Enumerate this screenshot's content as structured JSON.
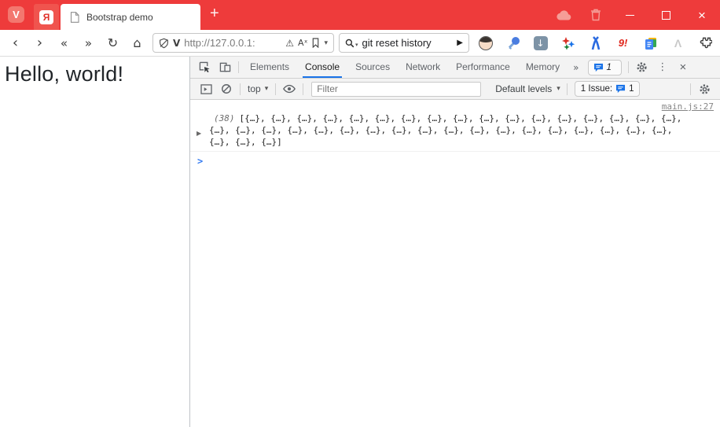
{
  "titlebar": {
    "vivaldi_logo": "V",
    "pinned_tab_letter": "Я",
    "tab_title": "Bootstrap demo",
    "new_tab": "+",
    "close": "×"
  },
  "navbar": {
    "back": "‹",
    "forward": "›",
    "rewind": "«",
    "fast_forward": "»",
    "reload": "↻",
    "home": "⌂",
    "address": {
      "url": "http://127.0.0.1:",
      "warning": "⚠",
      "translate": "Aˣ",
      "caret": "▾"
    },
    "search": {
      "value": "git reset history",
      "go": "▶",
      "caret": "▾"
    },
    "extensions": {
      "download_arrow": "↓",
      "red_badge": "9!",
      "lambda": "Λ"
    }
  },
  "page": {
    "heading": "Hello, world!"
  },
  "devtools": {
    "tabs": [
      "Elements",
      "Console",
      "Sources",
      "Network",
      "Performance",
      "Memory"
    ],
    "active_tab": "Console",
    "more_tabs": "»",
    "tab_issue_count": "1",
    "overflow_menu": "⋮",
    "close": "×",
    "toolbar": {
      "context": "top",
      "caret": "▾",
      "filter_placeholder": "Filter",
      "levels": "Default levels",
      "issues_label": "1 Issue:",
      "issues_count": "1"
    },
    "console": {
      "source_link": "main.js:27",
      "expand": "▶",
      "count": "(38)",
      "line1": "[{…}, {…}, {…}, {…}, {…}, {…}, {…}, {…}, {…}, {…}, {…}, {…}, {…}, {…}, {…}, {…}, {…},",
      "line2": "{…}, {…}, {…}, {…}, {…}, {…}, {…}, {…}, {…}, {…}, {…}, {…}, {…}, {…}, {…}, {…}, {…}, {…},",
      "line3": "{…}, {…}, {…}]",
      "prompt": ">"
    }
  },
  "colors": {
    "titlebar_red": "#ee3b3b",
    "devtools_accent": "#1a73e8",
    "prompt_blue": "#367cf1"
  }
}
